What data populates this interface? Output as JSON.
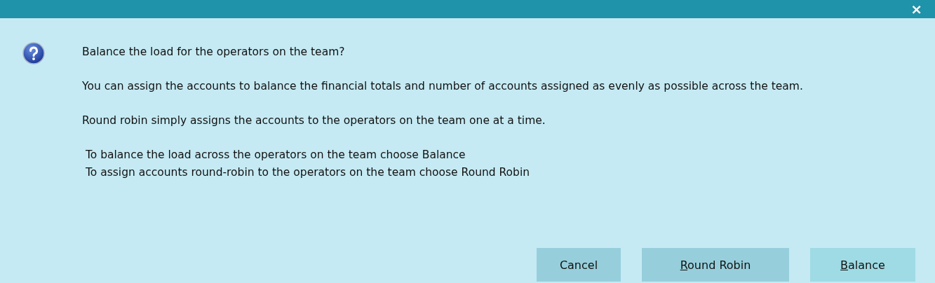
{
  "window": {
    "close_glyph": "×"
  },
  "paragraphs": [
    {
      "text": "Balance the load for the operators on the team?"
    },
    {
      "text": "You can assign the accounts to balance the financial totals and number of accounts assigned as evenly as possible across the team."
    },
    {
      "text": "Round robin simply assigns the accounts to the operators on the team one at a time."
    },
    {
      "lines": [
        " To balance the load across the operators on the team choose Balance",
        " To assign accounts round-robin to the operators on the team choose Round Robin"
      ]
    }
  ],
  "buttons": [
    {
      "label": "Cancel",
      "underline_first": false,
      "default": false,
      "kind": "small"
    },
    {
      "label": "Round Robin",
      "underline_first": true,
      "default": false,
      "kind": "wide"
    },
    {
      "label": "Balance",
      "underline_first": true,
      "default": true,
      "kind": "medium"
    }
  ]
}
